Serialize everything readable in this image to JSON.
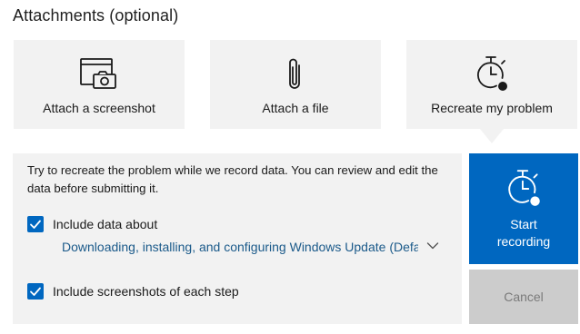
{
  "section_title": "Attachments (optional)",
  "tiles": [
    {
      "label": "Attach a screenshot",
      "icon": "screenshot-icon"
    },
    {
      "label": "Attach a file",
      "icon": "paperclip-icon"
    },
    {
      "label": "Recreate my problem",
      "icon": "stopwatch-record-icon"
    }
  ],
  "recreate": {
    "description": "Try to recreate the problem while we record data. You can review and edit the data before submitting it.",
    "include_data": {
      "label": "Include data about",
      "checked": true
    },
    "dropdown_value": "Downloading, installing, and configuring Windows Update (Default)",
    "include_screenshots": {
      "label": "Include screenshots of each step",
      "checked": true
    }
  },
  "buttons": {
    "start_label": "Start\nrecording",
    "start_icon": "stopwatch-record-icon",
    "cancel_label": "Cancel"
  },
  "colors": {
    "accent": "#0067c0",
    "tile_bg": "#f2f2f2",
    "link": "#1b5a8a",
    "disabled_bg": "#cccccc"
  }
}
